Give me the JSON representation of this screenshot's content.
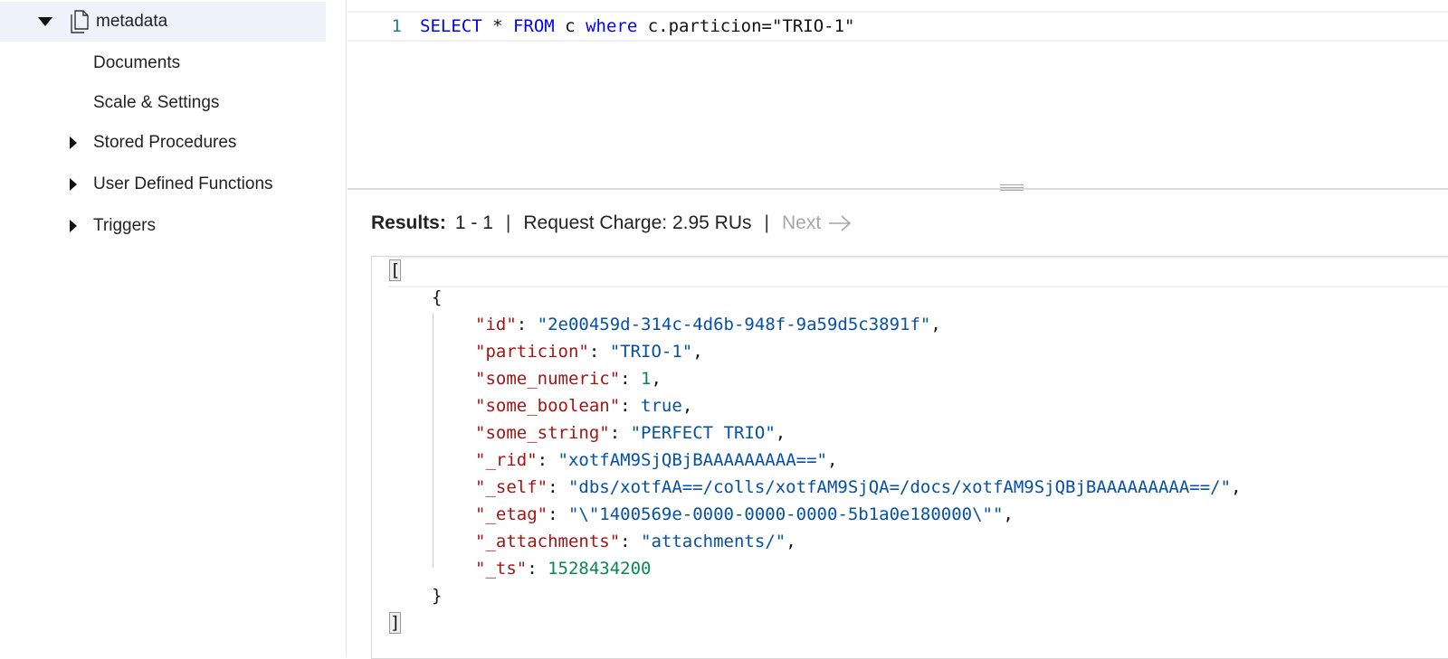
{
  "sidebar": {
    "container": "metadata",
    "items": [
      {
        "label": "Documents",
        "expandable": false
      },
      {
        "label": "Scale & Settings",
        "expandable": false
      },
      {
        "label": "Stored Procedures",
        "expandable": true
      },
      {
        "label": "User Defined Functions",
        "expandable": true
      },
      {
        "label": "Triggers",
        "expandable": true
      }
    ]
  },
  "editor": {
    "line_number": "1",
    "tokens": {
      "select": "SELECT",
      "star": " * ",
      "from": "FROM",
      "alias": " c ",
      "where": "where",
      "condition": " c.particion=\"TRIO-1\""
    }
  },
  "results": {
    "label": "Results:",
    "range": "1 - 1",
    "separator": "|",
    "charge": "Request Charge: 2.95 RUs",
    "next_label": "Next"
  },
  "json_result": {
    "open_bracket": "[",
    "open_brace": "{",
    "close_brace": "}",
    "close_bracket": "]",
    "fields": [
      {
        "key": "\"id\"",
        "value": "\"2e00459d-314c-4d6b-948f-9a59d5c3891f\"",
        "type": "string"
      },
      {
        "key": "\"particion\"",
        "value": "\"TRIO-1\"",
        "type": "string"
      },
      {
        "key": "\"some_numeric\"",
        "value": "1",
        "type": "number"
      },
      {
        "key": "\"some_boolean\"",
        "value": "true",
        "type": "bool"
      },
      {
        "key": "\"some_string\"",
        "value": "\"PERFECT TRIO\"",
        "type": "string"
      },
      {
        "key": "\"_rid\"",
        "value": "\"xotfAM9SjQBjBAAAAAAAAA==\"",
        "type": "string"
      },
      {
        "key": "\"_self\"",
        "value": "\"dbs/xotfAA==/colls/xotfAM9SjQA=/docs/xotfAM9SjQBjBAAAAAAAAA==/\"",
        "type": "string"
      },
      {
        "key": "\"_etag\"",
        "value": "\"\\\"1400569e-0000-0000-0000-5b1a0e180000\\\"\"",
        "type": "string"
      },
      {
        "key": "\"_attachments\"",
        "value": "\"attachments/\"",
        "type": "string"
      },
      {
        "key": "\"_ts\"",
        "value": "1528434200",
        "type": "number"
      }
    ]
  }
}
